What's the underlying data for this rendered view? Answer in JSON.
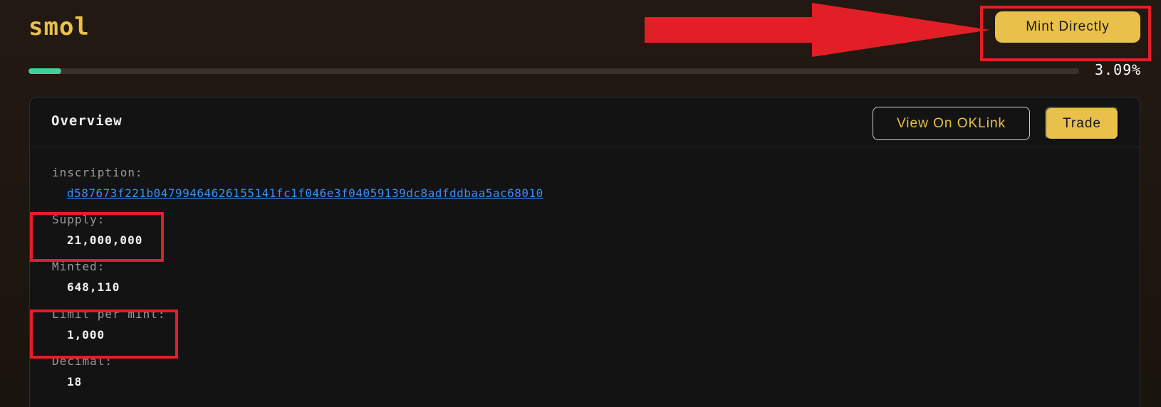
{
  "header": {
    "title": "smol",
    "mint_button_label": "Mint Directly"
  },
  "progress": {
    "percent_label": "3.09%",
    "fraction": 0.0309
  },
  "overview": {
    "title": "Overview",
    "oklink_button_label": "View On OKLink",
    "trade_button_label": "Trade",
    "fields": {
      "inscription": {
        "label": "inscription:",
        "value": "d587673f221b04799464626155141fc1f046e3f04059139dc8adfddbaa5ac68010"
      },
      "supply": {
        "label": "Supply:",
        "value": "21,000,000"
      },
      "minted": {
        "label": "Minted:",
        "value": "648,110"
      },
      "limit": {
        "label": "Limit per mint:",
        "value": "1,000"
      },
      "decimal": {
        "label": "Decimal:",
        "value": "18"
      }
    }
  },
  "colors": {
    "accent": "#e8c04a",
    "progress": "#3fcf9a",
    "link": "#3d8ff5",
    "annotation": "#e21e26"
  }
}
